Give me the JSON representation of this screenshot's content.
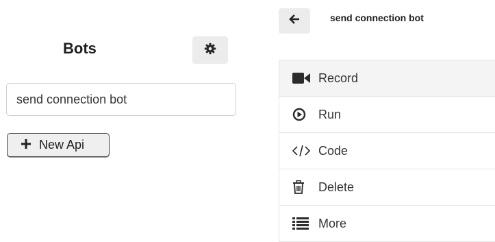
{
  "left_panel": {
    "title": "Bots",
    "settings_icon": "gear-icon",
    "search_value": "send connection bot",
    "new_api_label": "New Api",
    "new_api_icon": "plus-icon"
  },
  "right_panel": {
    "back_icon": "arrow-left-icon",
    "bot_name": "send connection bot",
    "menu": [
      {
        "label": "Record",
        "icon": "video-camera-icon"
      },
      {
        "label": "Run",
        "icon": "play-circle-icon"
      },
      {
        "label": "Code",
        "icon": "code-icon"
      },
      {
        "label": "Delete",
        "icon": "trash-icon"
      },
      {
        "label": "More",
        "icon": "list-icon"
      }
    ]
  },
  "colors": {
    "button_bg": "#ececec",
    "icon_dark": "#2b2b2b",
    "selected_row_bg": "#f4f4f4",
    "border": "#e3e3e3"
  }
}
